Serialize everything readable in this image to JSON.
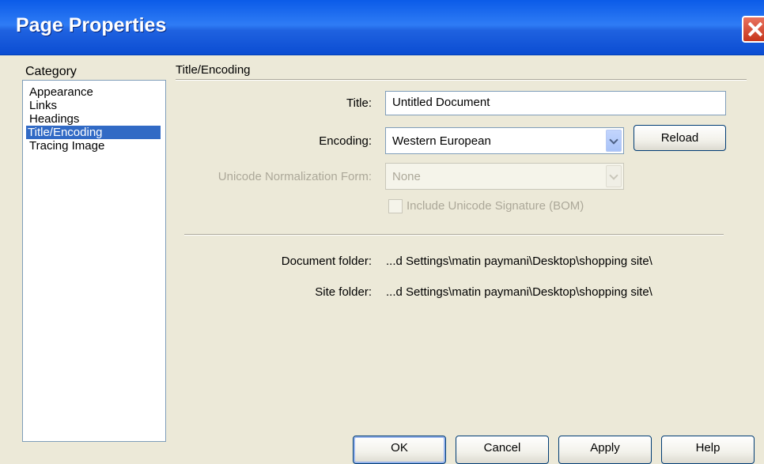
{
  "window": {
    "title": "Page Properties"
  },
  "category": {
    "label": "Category",
    "items": [
      "Appearance",
      "Links",
      "Headings",
      "Title/Encoding",
      "Tracing Image"
    ],
    "selected": "Title/Encoding"
  },
  "panel": {
    "title": "Title/Encoding",
    "title_label": "Title:",
    "title_value": "Untitled Document",
    "encoding_label": "Encoding:",
    "encoding_value": "Western European",
    "reload_label": "Reload",
    "normalization_label": "Unicode Normalization Form:",
    "normalization_value": "None",
    "bom_label": "Include Unicode Signature (BOM)",
    "document_folder_label": "Document folder:",
    "document_folder_value": "...d Settings\\matin paymani\\Desktop\\shopping site\\",
    "site_folder_label": "Site folder:",
    "site_folder_value": "...d Settings\\matin paymani\\Desktop\\shopping site\\"
  },
  "buttons": {
    "ok": "OK",
    "cancel": "Cancel",
    "apply": "Apply",
    "help": "Help"
  },
  "colors": {
    "titlebar": "#0b5be8",
    "selection": "#316ac5",
    "dialog_bg": "#ece9d8"
  }
}
